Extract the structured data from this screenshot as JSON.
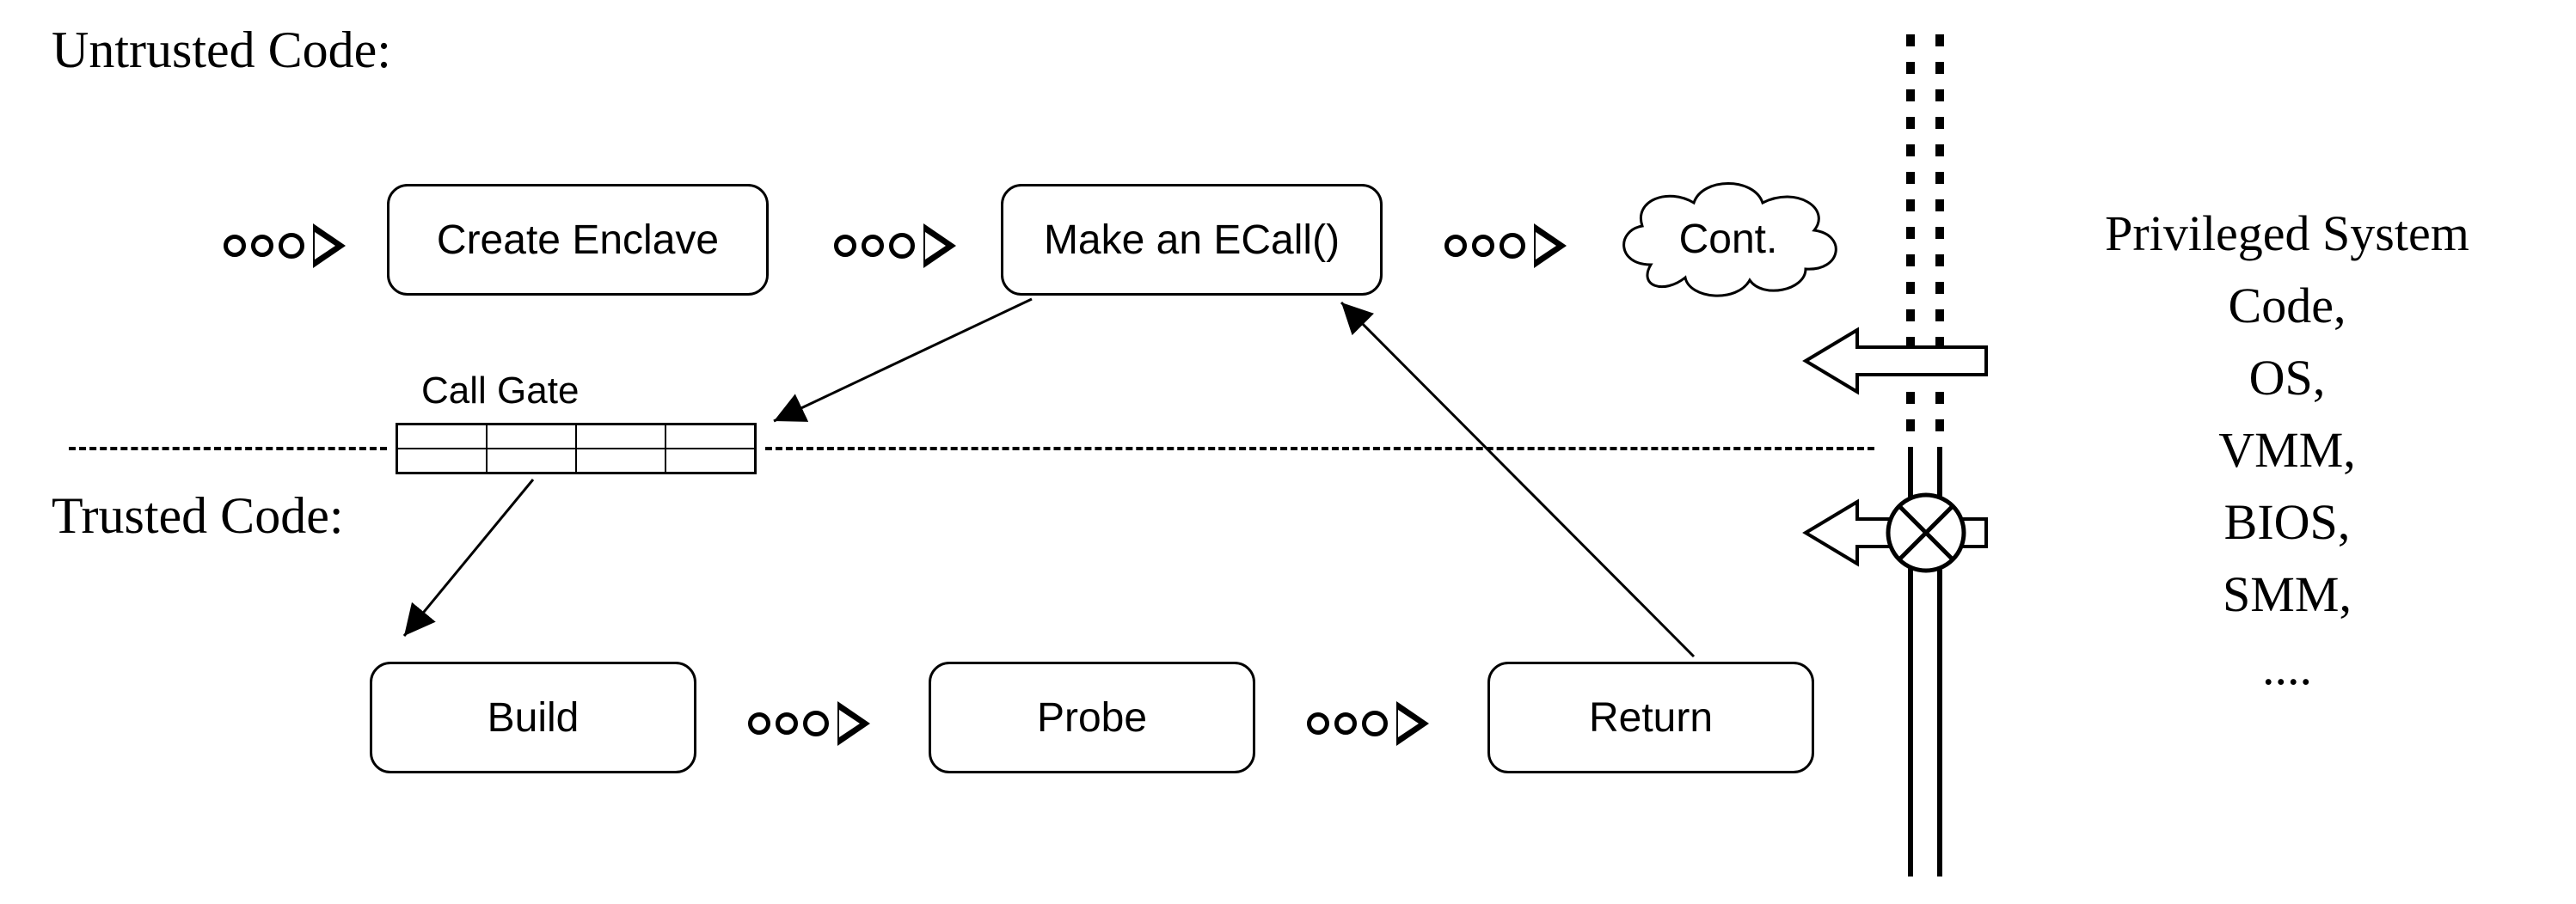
{
  "labels": {
    "untrusted": "Untrusted Code:",
    "trusted": "Trusted Code:",
    "callgate": "Call Gate"
  },
  "boxes": {
    "create": "Create Enclave",
    "ecall": "Make an ECall()",
    "cont": "Cont.",
    "build": "Build",
    "probe": "Probe",
    "return": "Return"
  },
  "privileged": {
    "line1": "Privileged System",
    "line2": "Code,",
    "line3": "OS,",
    "line4": "VMM,",
    "line5": "BIOS,",
    "line6": "SMM,",
    "line7": "...."
  }
}
